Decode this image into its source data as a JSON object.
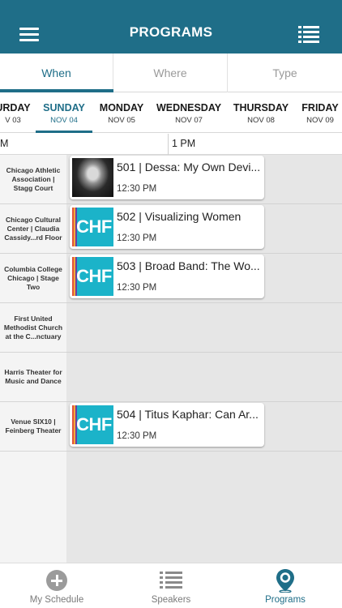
{
  "header": {
    "title": "PROGRAMS"
  },
  "segments": [
    {
      "label": "When",
      "active": true
    },
    {
      "label": "Where",
      "active": false
    },
    {
      "label": "Type",
      "active": false
    }
  ],
  "days": [
    {
      "name": "URDAY",
      "date": "V 03",
      "active": false
    },
    {
      "name": "SUNDAY",
      "date": "NOV 04",
      "active": true
    },
    {
      "name": "MONDAY",
      "date": "NOV 05",
      "active": false
    },
    {
      "name": "WEDNESDAY",
      "date": "NOV 07",
      "active": false
    },
    {
      "name": "THURSDAY",
      "date": "NOV 08",
      "active": false
    },
    {
      "name": "FRIDAY",
      "date": "NOV 09",
      "active": false
    }
  ],
  "times": [
    "M",
    "1 PM"
  ],
  "venues": [
    "Chicago Athletic Association | Stagg Court",
    "Chicago Cultural Center | Claudia Cassidy...rd Floor",
    "Columbia College Chicago | Stage Two",
    "First United Methodist Church at the C...nctuary",
    "Harris Theater for Music and Dance",
    "Venue SIX10 | Feinberg Theater"
  ],
  "programs": [
    {
      "title": "501 | Dessa: My Own Devi...",
      "time": "12:30 PM",
      "thumb": "photo"
    },
    {
      "title": "502 | Visualizing Women",
      "time": "12:30 PM",
      "thumb": "CHF"
    },
    {
      "title": "503 | Broad Band: The Wo...",
      "time": "12:30 PM",
      "thumb": "CHF"
    },
    {
      "title": "504 | Titus Kaphar: Can Ar...",
      "time": "12:30 PM",
      "thumb": "CHF"
    }
  ],
  "bottom_nav": [
    {
      "label": "My Schedule",
      "icon": "plus-circle-icon",
      "active": false
    },
    {
      "label": "Speakers",
      "icon": "list-icon",
      "active": false
    },
    {
      "label": "Programs",
      "icon": "map-pin-icon",
      "active": true
    }
  ],
  "colors": {
    "primary": "#1f6e88",
    "chf_teal": "#1bb3c9"
  }
}
